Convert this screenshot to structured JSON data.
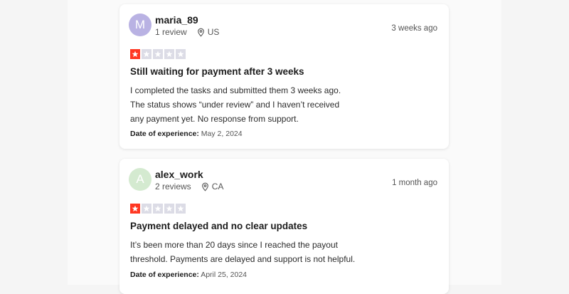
{
  "reviews": [
    {
      "avatar_letter": "M",
      "avatar_color": "#b9b2e3",
      "avatar_text_color": "#ffffff",
      "username": "maria_89",
      "review_count": "1 review",
      "country": "US",
      "time_ago": "3 weeks ago",
      "rating": 1,
      "title": "Still waiting for payment after 3 weeks",
      "body_lines": [
        "I completed the tasks and submitted them 3 weeks ago.",
        "The status shows “under review” and I haven’t received",
        "any payment yet. No response from support."
      ],
      "date_label": "Date of experience:",
      "date_value": "May 2, 2024"
    },
    {
      "avatar_letter": "A",
      "avatar_color": "#d4ead0",
      "avatar_text_color": "#ffffff",
      "username": "alex_work",
      "review_count": "2 reviews",
      "country": "CA",
      "time_ago": "1 month ago",
      "rating": 1,
      "title": "Payment delayed and no clear updates",
      "body_lines": [
        "It’s been more than 20 days since I reached the payout",
        "threshold. Payments are delayed and support is not helpful."
      ],
      "date_label": "Date of experience:",
      "date_value": "April 25, 2024"
    }
  ],
  "colors": {
    "star_filled": "#ff3722",
    "star_empty": "#dcdce6"
  },
  "icons": {
    "location": "map-pin-icon",
    "star": "star-icon"
  }
}
